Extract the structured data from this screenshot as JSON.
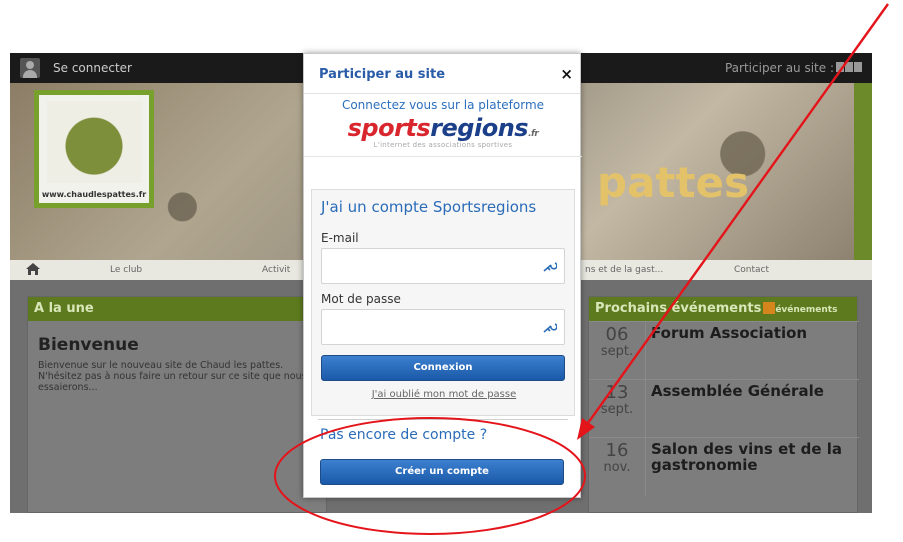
{
  "topbar": {
    "login_label": "Se connecter",
    "participer_label": "Participer au site :"
  },
  "banner": {
    "title_visible": "pattes",
    "logo_url_text": "www.chaudlespattes.fr"
  },
  "navbar": {
    "items": [
      "Le club",
      "Activit",
      "ns et de la gast...",
      "Contact"
    ]
  },
  "left_panel": {
    "heading": "A la une",
    "title": "Bienvenue",
    "text": "Bienvenue sur le nouveau site de Chaud les pattes. N'hésitez pas à nous faire un retour sur ce site que nous essaierons..."
  },
  "right_panel": {
    "heading": "Prochains événements",
    "rss_label": "événements",
    "events": [
      {
        "day": "06",
        "month": "sept.",
        "title": "Forum Association"
      },
      {
        "day": "13",
        "month": "sept.",
        "title": "Assemblée Générale"
      },
      {
        "day": "16",
        "month": "nov.",
        "title": "Salon des vins et de la gastronomie"
      }
    ]
  },
  "modal": {
    "title": "Participer au site",
    "close_label": "×",
    "platform_text": "Connectez vous sur la plateforme",
    "brand_sp": "sp",
    "brand_o": "o",
    "brand_rts": "rts",
    "brand_regions": "regions",
    "brand_fr": ".fr",
    "tagline": "L'internet des associations sportives",
    "login": {
      "title": "J'ai un compte Sportsregions",
      "email_label": "E-mail",
      "email_value": "",
      "password_label": "Mot de passe",
      "password_value": "",
      "submit_label": "Connexion",
      "forgot_label": "J'ai oublié mon mot de passe"
    },
    "no_account_label": "Pas encore de compte ?",
    "create_label": "Créer un compte"
  },
  "colors": {
    "accent_blue": "#2a6cb8",
    "button_blue": "#1a59a8",
    "annotation_red": "#e4141b",
    "green": "#6d8a2a"
  }
}
